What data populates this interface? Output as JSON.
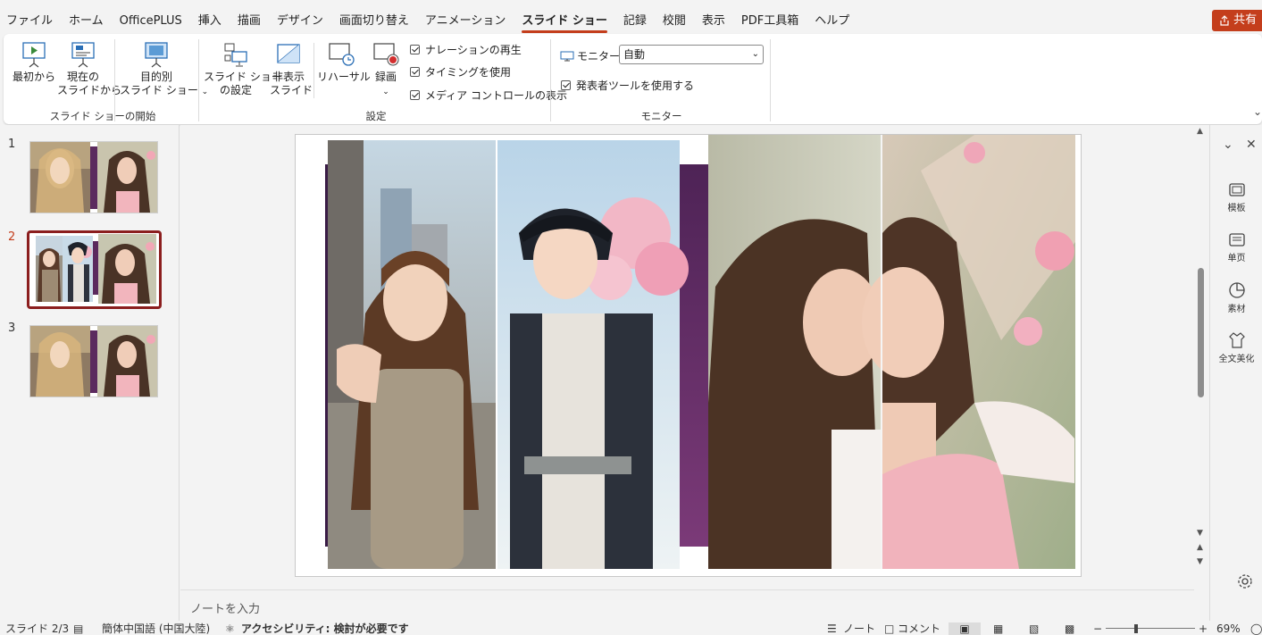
{
  "menubar": {
    "tabs": [
      "ファイル",
      "ホーム",
      "OfficePLUS",
      "挿入",
      "描画",
      "デザイン",
      "画面切り替え",
      "アニメーション",
      "スライド ショー",
      "記録",
      "校閲",
      "表示",
      "PDF工具箱",
      "ヘルプ"
    ],
    "active_tab": "スライド ショー",
    "share_label": "共有"
  },
  "ribbon": {
    "start_group": {
      "label": "スライド ショーの開始",
      "from_beginning": "最初から",
      "from_current_1": "現在の",
      "from_current_2": "スライドから",
      "custom_1": "目的別",
      "custom_2": "スライド ショー"
    },
    "setup_group": {
      "label": "設定",
      "setup_show_1": "スライド ショー",
      "setup_show_2": "の設定",
      "hide_slide_1": "非表示",
      "hide_slide_2": "スライド",
      "rehearse": "リハーサル",
      "record": "録画",
      "play_narrations": "ナレーションの再生",
      "use_timings": "タイミングを使用",
      "show_media_controls": "メディア コントロールの表示"
    },
    "monitor_group": {
      "label": "モニター",
      "monitor_label": "モニター:",
      "monitor_value": "自動",
      "presenter_view": "発表者ツールを使用する"
    }
  },
  "thumbnails": {
    "items": [
      "1",
      "2",
      "3"
    ],
    "selected": "2"
  },
  "notes": {
    "placeholder": "ノートを入力"
  },
  "sidepane": {
    "items": [
      "模板",
      "单页",
      "素材",
      "全文美化"
    ]
  },
  "status": {
    "slide_counter": "スライド 2/3",
    "language": "簡体中国語 (中国大陸)",
    "accessibility": "アクセシビリティ: 検討が必要です",
    "notes": "ノート",
    "comments": "コメント",
    "zoom": "69%"
  },
  "colors": {
    "accent": "#c43e1c",
    "selected_thumb_border": "#8b1e1e",
    "slide_purple": "#5b2a5e"
  }
}
